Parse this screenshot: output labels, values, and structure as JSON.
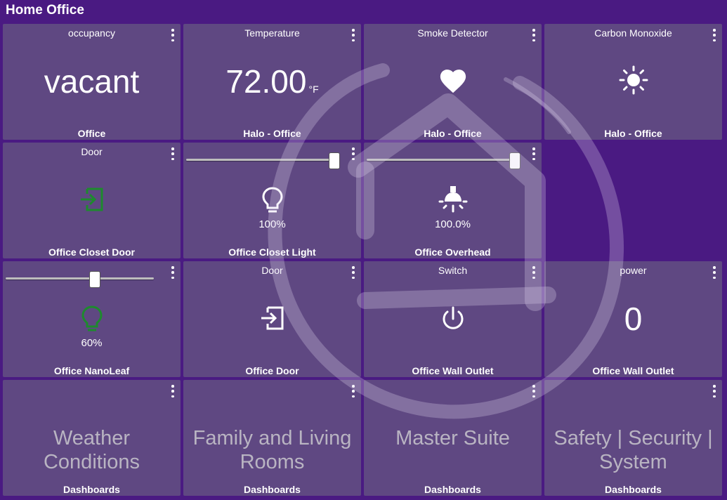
{
  "header": {
    "title": "Home Office"
  },
  "colors": {
    "background": "#4a1a82",
    "tile": "#5f4882",
    "green_icon": "#1e8a2e",
    "dim_text": "#b9b4c2"
  },
  "tiles": {
    "occupancy": {
      "title": "occupancy",
      "value": "vacant",
      "label": "Office"
    },
    "temperature": {
      "title": "Temperature",
      "value": "72.00",
      "unit": "°F",
      "label": "Halo - Office"
    },
    "smoke": {
      "title": "Smoke Detector",
      "icon": "heart-icon",
      "label": "Halo - Office"
    },
    "co": {
      "title": "Carbon Monoxide",
      "icon": "sun-icon",
      "label": "Halo - Office"
    },
    "closet_door": {
      "title": "Door",
      "icon": "door-enter-icon",
      "label": "Office Closet Door"
    },
    "closet_light": {
      "level": 100,
      "icon": "lightbulb-icon",
      "percent": "100%",
      "label": "Office Closet Light"
    },
    "overhead": {
      "level": 100,
      "icon": "ceiling-light-icon",
      "percent": "100.0%",
      "label": "Office Overhead"
    },
    "nanoleaf": {
      "level": 60,
      "icon": "lightbulb-icon",
      "percent": "60%",
      "label": "Office NanoLeaf"
    },
    "office_door": {
      "title": "Door",
      "icon": "door-enter-icon",
      "label": "Office Door"
    },
    "wall_switch": {
      "title": "Switch",
      "icon": "power-icon",
      "label": "Office Wall Outlet"
    },
    "wall_power": {
      "title": "power",
      "value": "0",
      "label": "Office Wall Outlet"
    },
    "weather": {
      "title": "Weather Conditions",
      "label": "Dashboards"
    },
    "family": {
      "title": "Family and Living Rooms",
      "label": "Dashboards"
    },
    "master": {
      "title": "Master Suite",
      "label": "Dashboards"
    },
    "safety": {
      "title": "Safety | Security | System",
      "label": "Dashboards"
    }
  }
}
